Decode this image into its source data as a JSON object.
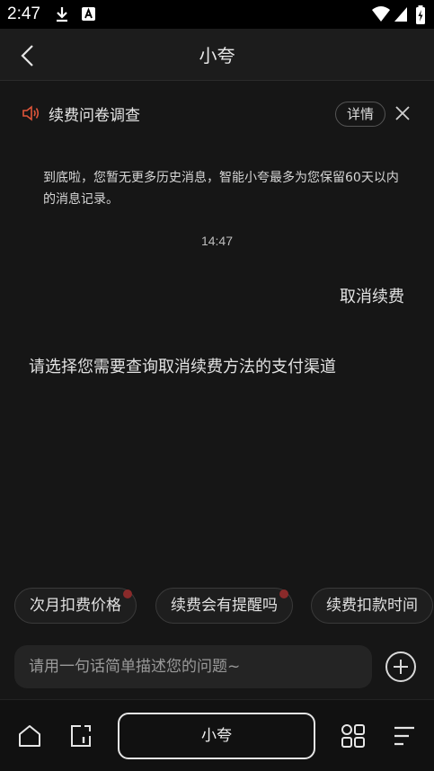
{
  "status_bar": {
    "time": "2:47"
  },
  "header": {
    "title": "小夸"
  },
  "survey": {
    "text": "续费问卷调查",
    "detail_label": "详情"
  },
  "chat": {
    "history_note": "到底啦，您暂无更多历史消息，智能小夸最多为您保留60天以内的消息记录。",
    "timestamp": "14:47",
    "user_message": "取消续费",
    "bot_message": "请选择您需要查询取消续费方法的支付渠道"
  },
  "suggestions": [
    {
      "label": "次月扣费价格",
      "has_dot": true
    },
    {
      "label": "续费会有提醒吗",
      "has_dot": true
    },
    {
      "label": "续费扣款时间",
      "has_dot": false
    }
  ],
  "input": {
    "placeholder": "请用一句话简单描述您的问题~"
  },
  "bottom_nav": {
    "center_label": "小夸"
  },
  "colors": {
    "background": "#161616",
    "accent_speaker": "#e0553a",
    "chip_dot": "#8a2a2a"
  }
}
